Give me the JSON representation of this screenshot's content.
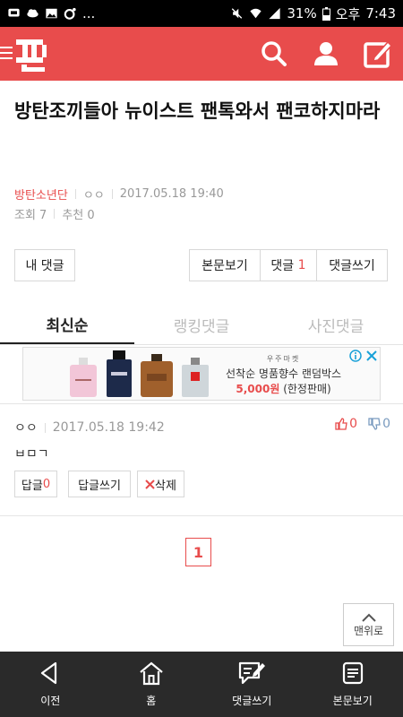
{
  "status_bar": {
    "dots": "...",
    "battery": "31%",
    "ampm": "오후",
    "time": "7:43"
  },
  "appbar": {
    "logo_text": "판",
    "bg_color": "#e84c4c"
  },
  "post": {
    "title": "방탄조끼들아 뉴이스트 팬톡와서 팬코하지마라",
    "author": "방탄소년단",
    "nick": "ㅇㅇ",
    "datetime": "2017.05.18 19:40",
    "views_label": "조회 7",
    "recommend_label": "추천 0"
  },
  "actions": {
    "my_comments": "내 댓글",
    "view_post": "본문보기",
    "comments_label": "댓글",
    "comments_count": "1",
    "write_comment": "댓글쓰기"
  },
  "tabs": [
    {
      "label": "최신순",
      "active": true
    },
    {
      "label": "랭킹댓글",
      "active": false
    },
    {
      "label": "사진댓글",
      "active": false
    }
  ],
  "ad": {
    "small": "우주마켓",
    "line1": "선착순 명품향수 랜덤박스",
    "price": "5,000원",
    "suffix": "(한정판매)"
  },
  "comment": {
    "nick": "ㅇㅇ",
    "datetime": "2017.05.18 19:42",
    "up": "0",
    "down": "0",
    "text": "ㅂㅁㄱ",
    "reply_label": "답글",
    "reply_count": "0",
    "write_reply": "답글쓰기",
    "delete": "삭제"
  },
  "pagination": {
    "current": "1"
  },
  "top_button": "맨위로",
  "bottom_nav": [
    {
      "label": "이전",
      "icon": "back-icon"
    },
    {
      "label": "홈",
      "icon": "home-icon"
    },
    {
      "label": "댓글쓰기",
      "icon": "comment-write-icon"
    },
    {
      "label": "본문보기",
      "icon": "document-icon"
    }
  ]
}
